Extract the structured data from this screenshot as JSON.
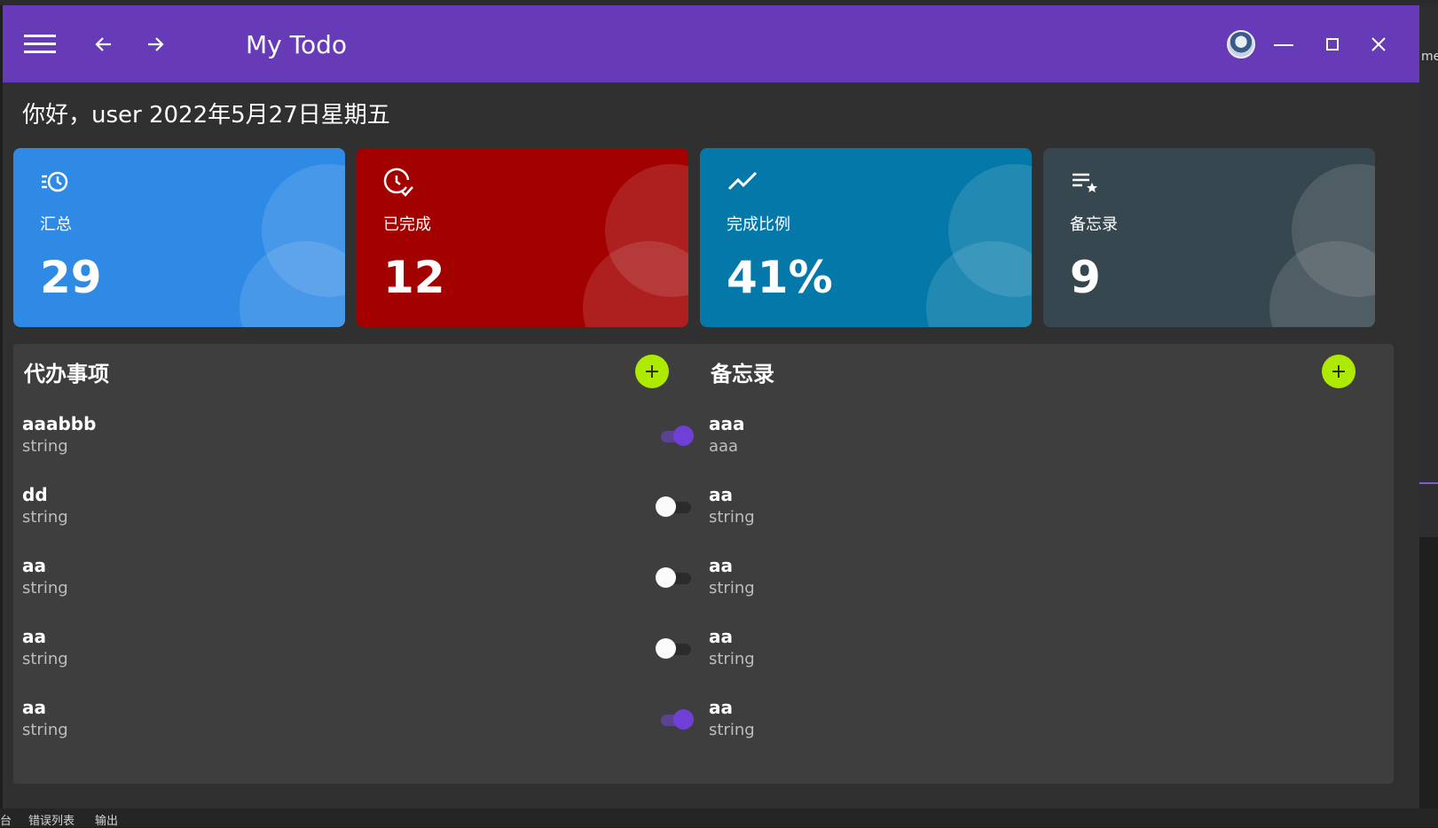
{
  "app": {
    "title": "My Todo"
  },
  "greeting": "你好，user 2022年5月27日星期五",
  "cards": [
    {
      "label": "汇总",
      "value": "29",
      "color": "#2f8ae6",
      "icon": "history-icon"
    },
    {
      "label": "已完成",
      "value": "12",
      "color": "#a30000",
      "icon": "clock-check-icon"
    },
    {
      "label": "完成比例",
      "value": "41%",
      "color": "#0479a9",
      "icon": "trend-icon"
    },
    {
      "label": "备忘录",
      "value": "9",
      "color": "#37474f",
      "icon": "playlist-star-icon"
    }
  ],
  "todo_panel": {
    "title": "代办事项",
    "add_label": "+",
    "items": [
      {
        "title": "aaabbb",
        "content": "string",
        "done": true
      },
      {
        "title": "dd",
        "content": "string",
        "done": false
      },
      {
        "title": "aa",
        "content": "string",
        "done": false
      },
      {
        "title": "aa",
        "content": "string",
        "done": false
      },
      {
        "title": "aa",
        "content": "string",
        "done": true
      }
    ]
  },
  "memo_panel": {
    "title": "备忘录",
    "add_label": "+",
    "items": [
      {
        "title": "aaa",
        "content": "aaa"
      },
      {
        "title": "aa",
        "content": "string"
      },
      {
        "title": "aa",
        "content": "string"
      },
      {
        "title": "aa",
        "content": "string"
      },
      {
        "title": "aa",
        "content": "string"
      }
    ]
  },
  "ide": {
    "right_label": "me",
    "bottom_tabs": [
      "台",
      "错误列表",
      "输出"
    ]
  }
}
